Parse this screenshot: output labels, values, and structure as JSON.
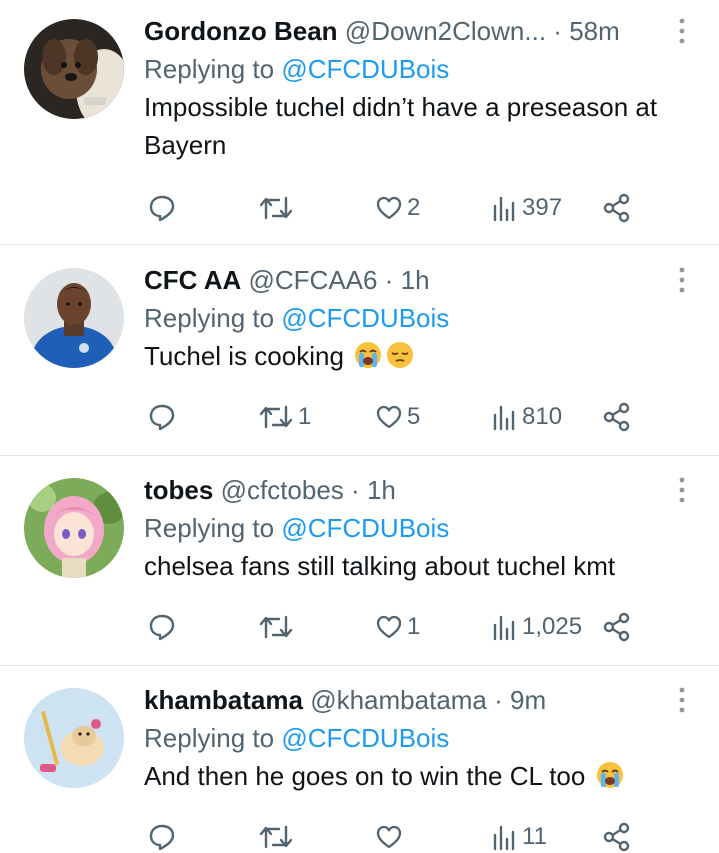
{
  "tweets": [
    {
      "name": "Gordonzo Bean",
      "handle": "@Down2Clown...",
      "separator": "·",
      "time": "58m",
      "replying_prefix": "Replying to",
      "replying_to": "@CFCDUBois",
      "text": "Impossible tuchel didn’t have a preseason at Bayern",
      "replies": "",
      "retweets": "",
      "likes": "2",
      "views": "397",
      "emojis": []
    },
    {
      "name": "CFC AA",
      "handle": "@CFCAA6",
      "separator": "·",
      "time": "1h",
      "replying_prefix": "Replying to",
      "replying_to": "@CFCDUBois",
      "text": "Tuchel is cooking",
      "replies": "",
      "retweets": "1",
      "likes": "5",
      "views": "810",
      "emojis": [
        "loudly-crying-face-emoji",
        "pensive-face-emoji"
      ]
    },
    {
      "name": "tobes",
      "handle": "@cfctobes",
      "separator": "·",
      "time": "1h",
      "replying_prefix": "Replying to",
      "replying_to": "@CFCDUBois",
      "text": "chelsea fans still talking about tuchel kmt",
      "replies": "",
      "retweets": "",
      "likes": "1",
      "views": "1,025",
      "emojis": []
    },
    {
      "name": "khambatama",
      "handle": "@khambatama",
      "separator": "·",
      "time": "9m",
      "replying_prefix": "Replying to",
      "replying_to": "@CFCDUBois",
      "text": "And then he goes on to win the CL too",
      "replies": "",
      "retweets": "",
      "likes": "",
      "views": "11",
      "emojis": [
        "loudly-crying-face-emoji"
      ]
    }
  ],
  "colors": {
    "text": "#0f1419",
    "secondary": "#536471",
    "link": "#1d9bf0",
    "divider": "#dfe3e6"
  }
}
